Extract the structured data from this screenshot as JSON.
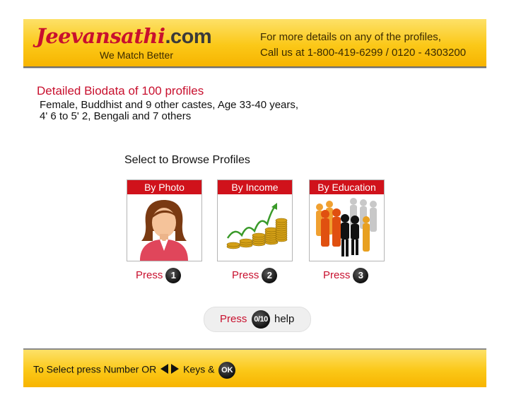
{
  "header": {
    "logo_main": "Jeevansathi",
    "logo_suffix": ".com",
    "tagline": "We Match Better",
    "contact_line1": "For more details on any of the profiles,",
    "contact_line2": "Call us at 1-800-419-6299 / 0120 - 4303200"
  },
  "biodata": {
    "title": "Detailed Biodata of 100 profiles",
    "line1": "Female, Buddhist and 9 other castes, Age 33-40 years,",
    "line2": "4' 6 to 5' 2, Bengali and 7 others"
  },
  "browse": {
    "label": "Select to Browse Profiles",
    "options": [
      {
        "title": "By Photo",
        "press": "Press",
        "key": "1",
        "icon": "woman-avatar-icon"
      },
      {
        "title": "By Income",
        "press": "Press",
        "key": "2",
        "icon": "coin-stack-growth-icon"
      },
      {
        "title": "By Education",
        "press": "Press",
        "key": "3",
        "icon": "crowd-people-icon"
      }
    ]
  },
  "help": {
    "press": "Press",
    "key": "0/10",
    "label": "help"
  },
  "footer": {
    "text_before": "To Select press Number OR",
    "text_after": "Keys &",
    "ok": "OK"
  },
  "colors": {
    "brand_red": "#c8102e",
    "header_yellow": "#fbc818",
    "card_header_red": "#d0121b"
  }
}
